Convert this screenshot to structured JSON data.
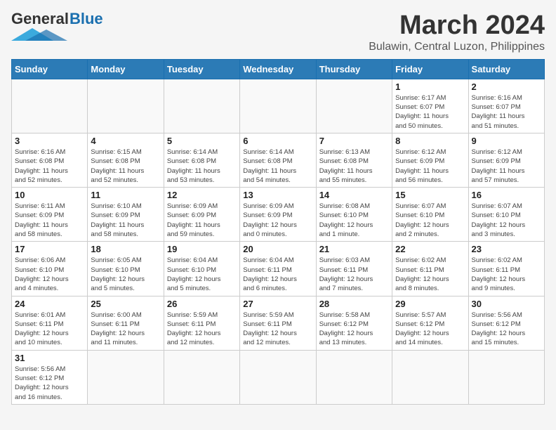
{
  "logo": {
    "text_general": "General",
    "text_blue": "Blue"
  },
  "title": "March 2024",
  "subtitle": "Bulawin, Central Luzon, Philippines",
  "header": {
    "days": [
      "Sunday",
      "Monday",
      "Tuesday",
      "Wednesday",
      "Thursday",
      "Friday",
      "Saturday"
    ]
  },
  "weeks": [
    {
      "days": [
        {
          "num": "",
          "info": ""
        },
        {
          "num": "",
          "info": ""
        },
        {
          "num": "",
          "info": ""
        },
        {
          "num": "",
          "info": ""
        },
        {
          "num": "",
          "info": ""
        },
        {
          "num": "1",
          "info": "Sunrise: 6:17 AM\nSunset: 6:07 PM\nDaylight: 11 hours\nand 50 minutes."
        },
        {
          "num": "2",
          "info": "Sunrise: 6:16 AM\nSunset: 6:07 PM\nDaylight: 11 hours\nand 51 minutes."
        }
      ]
    },
    {
      "days": [
        {
          "num": "3",
          "info": "Sunrise: 6:16 AM\nSunset: 6:08 PM\nDaylight: 11 hours\nand 52 minutes."
        },
        {
          "num": "4",
          "info": "Sunrise: 6:15 AM\nSunset: 6:08 PM\nDaylight: 11 hours\nand 52 minutes."
        },
        {
          "num": "5",
          "info": "Sunrise: 6:14 AM\nSunset: 6:08 PM\nDaylight: 11 hours\nand 53 minutes."
        },
        {
          "num": "6",
          "info": "Sunrise: 6:14 AM\nSunset: 6:08 PM\nDaylight: 11 hours\nand 54 minutes."
        },
        {
          "num": "7",
          "info": "Sunrise: 6:13 AM\nSunset: 6:08 PM\nDaylight: 11 hours\nand 55 minutes."
        },
        {
          "num": "8",
          "info": "Sunrise: 6:12 AM\nSunset: 6:09 PM\nDaylight: 11 hours\nand 56 minutes."
        },
        {
          "num": "9",
          "info": "Sunrise: 6:12 AM\nSunset: 6:09 PM\nDaylight: 11 hours\nand 57 minutes."
        }
      ]
    },
    {
      "days": [
        {
          "num": "10",
          "info": "Sunrise: 6:11 AM\nSunset: 6:09 PM\nDaylight: 11 hours\nand 58 minutes."
        },
        {
          "num": "11",
          "info": "Sunrise: 6:10 AM\nSunset: 6:09 PM\nDaylight: 11 hours\nand 58 minutes."
        },
        {
          "num": "12",
          "info": "Sunrise: 6:09 AM\nSunset: 6:09 PM\nDaylight: 11 hours\nand 59 minutes."
        },
        {
          "num": "13",
          "info": "Sunrise: 6:09 AM\nSunset: 6:09 PM\nDaylight: 12 hours\nand 0 minutes."
        },
        {
          "num": "14",
          "info": "Sunrise: 6:08 AM\nSunset: 6:10 PM\nDaylight: 12 hours\nand 1 minute."
        },
        {
          "num": "15",
          "info": "Sunrise: 6:07 AM\nSunset: 6:10 PM\nDaylight: 12 hours\nand 2 minutes."
        },
        {
          "num": "16",
          "info": "Sunrise: 6:07 AM\nSunset: 6:10 PM\nDaylight: 12 hours\nand 3 minutes."
        }
      ]
    },
    {
      "days": [
        {
          "num": "17",
          "info": "Sunrise: 6:06 AM\nSunset: 6:10 PM\nDaylight: 12 hours\nand 4 minutes."
        },
        {
          "num": "18",
          "info": "Sunrise: 6:05 AM\nSunset: 6:10 PM\nDaylight: 12 hours\nand 5 minutes."
        },
        {
          "num": "19",
          "info": "Sunrise: 6:04 AM\nSunset: 6:10 PM\nDaylight: 12 hours\nand 5 minutes."
        },
        {
          "num": "20",
          "info": "Sunrise: 6:04 AM\nSunset: 6:11 PM\nDaylight: 12 hours\nand 6 minutes."
        },
        {
          "num": "21",
          "info": "Sunrise: 6:03 AM\nSunset: 6:11 PM\nDaylight: 12 hours\nand 7 minutes."
        },
        {
          "num": "22",
          "info": "Sunrise: 6:02 AM\nSunset: 6:11 PM\nDaylight: 12 hours\nand 8 minutes."
        },
        {
          "num": "23",
          "info": "Sunrise: 6:02 AM\nSunset: 6:11 PM\nDaylight: 12 hours\nand 9 minutes."
        }
      ]
    },
    {
      "days": [
        {
          "num": "24",
          "info": "Sunrise: 6:01 AM\nSunset: 6:11 PM\nDaylight: 12 hours\nand 10 minutes."
        },
        {
          "num": "25",
          "info": "Sunrise: 6:00 AM\nSunset: 6:11 PM\nDaylight: 12 hours\nand 11 minutes."
        },
        {
          "num": "26",
          "info": "Sunrise: 5:59 AM\nSunset: 6:11 PM\nDaylight: 12 hours\nand 12 minutes."
        },
        {
          "num": "27",
          "info": "Sunrise: 5:59 AM\nSunset: 6:11 PM\nDaylight: 12 hours\nand 12 minutes."
        },
        {
          "num": "28",
          "info": "Sunrise: 5:58 AM\nSunset: 6:12 PM\nDaylight: 12 hours\nand 13 minutes."
        },
        {
          "num": "29",
          "info": "Sunrise: 5:57 AM\nSunset: 6:12 PM\nDaylight: 12 hours\nand 14 minutes."
        },
        {
          "num": "30",
          "info": "Sunrise: 5:56 AM\nSunset: 6:12 PM\nDaylight: 12 hours\nand 15 minutes."
        }
      ]
    },
    {
      "days": [
        {
          "num": "31",
          "info": "Sunrise: 5:56 AM\nSunset: 6:12 PM\nDaylight: 12 hours\nand 16 minutes."
        },
        {
          "num": "",
          "info": ""
        },
        {
          "num": "",
          "info": ""
        },
        {
          "num": "",
          "info": ""
        },
        {
          "num": "",
          "info": ""
        },
        {
          "num": "",
          "info": ""
        },
        {
          "num": "",
          "info": ""
        }
      ]
    }
  ]
}
